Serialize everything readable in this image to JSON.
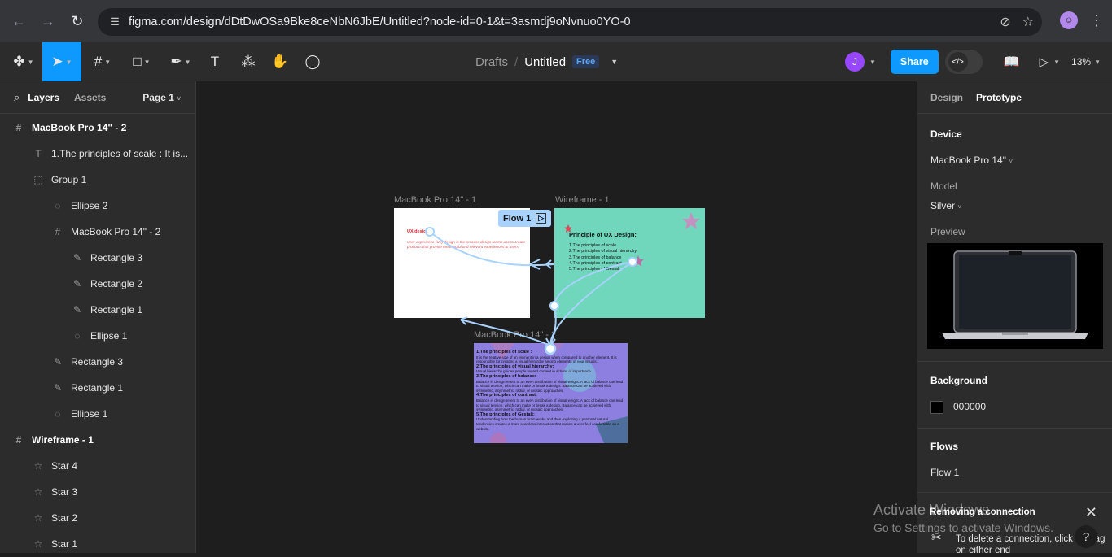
{
  "browser": {
    "url": "figma.com/design/dDtDwOSa9Bke8ceNbN6JbE/Untitled?node-id=0-1&t=3asmdj9oNvnuo0YO-0"
  },
  "toolbar": {
    "breadcrumb_parent": "Drafts",
    "file_title": "Untitled",
    "plan_badge": "Free",
    "avatar_initial": "J",
    "share_label": "Share",
    "zoom": "13%"
  },
  "left_panel": {
    "tab_layers": "Layers",
    "tab_assets": "Assets",
    "page_selector": "Page 1",
    "layers": [
      {
        "label": "MacBook Pro 14\" - 2",
        "icon": "frame-icon"
      },
      {
        "label": "1.The principles of scale : It is...",
        "icon": "text-icon"
      },
      {
        "label": "Group 1",
        "icon": "group-icon"
      },
      {
        "label": "Ellipse 2",
        "icon": "ellipse-icon"
      },
      {
        "label": "MacBook Pro 14\" - 2",
        "icon": "frame-icon"
      },
      {
        "label": "Rectangle 3",
        "icon": "vector-icon"
      },
      {
        "label": "Rectangle 2",
        "icon": "vector-icon"
      },
      {
        "label": "Rectangle 1",
        "icon": "vector-icon"
      },
      {
        "label": "Ellipse 1",
        "icon": "ellipse-icon"
      },
      {
        "label": "Rectangle 3",
        "icon": "vector-icon"
      },
      {
        "label": "Rectangle 1",
        "icon": "vector-icon"
      },
      {
        "label": "Ellipse 1",
        "icon": "ellipse-icon"
      },
      {
        "label": "Wireframe - 1",
        "icon": "frame-icon"
      },
      {
        "label": "Star 4",
        "icon": "star-icon"
      },
      {
        "label": "Star 3",
        "icon": "star-icon"
      },
      {
        "label": "Star 2",
        "icon": "star-icon"
      },
      {
        "label": "Star 1",
        "icon": "star-icon"
      }
    ]
  },
  "canvas": {
    "frame1_label": "MacBook Pro 14\" - 1",
    "wireframe_label": "Wireframe - 1",
    "frame2_label": "MacBook Pro 14\" - 2",
    "flow_tag": "Flow 1",
    "frame1_title": "UX design",
    "frame1_body": "User experience (UX) design is the process design teams use to create products that provide meaningful and relevant experiences to users.",
    "wire_title": "Principle of UX  Design:",
    "wire_items": [
      "1.The principles of scale",
      "2.The principles of  visual hierarchy",
      "3.The principles of balance",
      "4.The principles of contrast",
      "5.The principles of Gestalt"
    ],
    "frame2_blocks": [
      {
        "heading": "1.The principles of scale :",
        "body": "It is the relative size of an element in a design when compared to another element. It is responsible for creating a visual hierarchy among elements of your visuals."
      },
      {
        "heading": "2.The principles of  visual hierarchy:",
        "body": "Visual hierarchy guides people toward content in actions of importance."
      },
      {
        "heading": "3.The principles of balance:",
        "body": "Balance in design refers to an even distribution of visual weight. A lack of balance can lead to visual tension, which can make or break a design. Balance can be achieved with symmetric, asymmetric, radial, or mosaic approaches."
      },
      {
        "heading": "4.The principles of  contrast:",
        "body": "Balance in design refers to an even distribution of visual weight. A lack of balance can lead to visual tension, which can make or break a design. Balance can be achieved with symmetric, asymmetric, radial, or mosaic approaches."
      },
      {
        "heading": "5.The principles of Gestalt:",
        "body": "Understanding how the human brain works and then exploiting a personal natural tendencies creates a more seamless interaction that makes a user feel comfortable on a website."
      }
    ]
  },
  "right_panel": {
    "tab_design": "Design",
    "tab_prototype": "Prototype",
    "device_title": "Device",
    "device_value": "MacBook Pro 14\"",
    "model_label": "Model",
    "model_value": "Silver",
    "preview_label": "Preview",
    "background_title": "Background",
    "background_value": "000000",
    "flows_title": "Flows",
    "flow_item": "Flow 1"
  },
  "toast": {
    "title": "Removing a connection",
    "body": "To delete a connection, click or drag on either end"
  },
  "watermark": {
    "line1": "Activate Windows",
    "line2": "Go to Settings to activate Windows."
  },
  "colors": {
    "accent": "#0d99ff",
    "wireframe_bg": "#70d6bc",
    "frame2_bg": "#8c7fe0",
    "connector": "#a8d2ff"
  }
}
